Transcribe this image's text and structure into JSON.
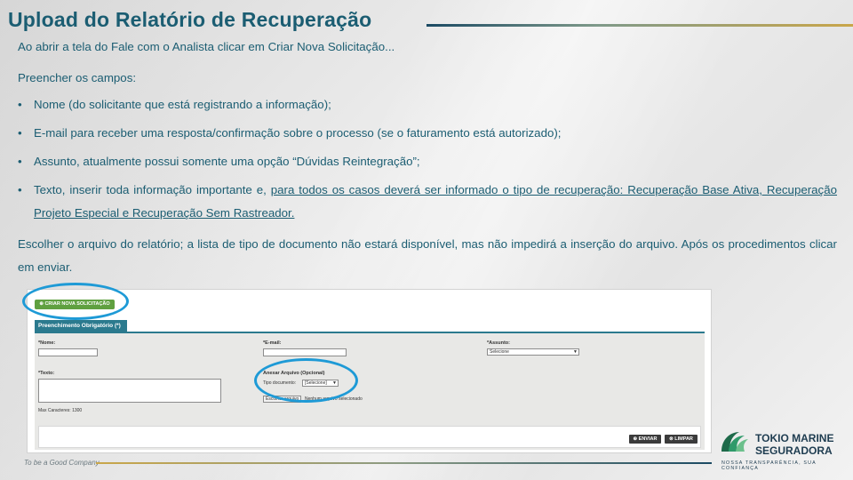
{
  "slide": {
    "title": "Upload do Relatório de Recuperação",
    "intro": "Ao abrir a tela do Fale com o Analista clicar em Criar Nova Solicitação...",
    "fill_fields": "Preencher os campos:",
    "bullets": [
      "Nome (do solicitante que está registrando a informação);",
      "E-mail para receber uma resposta/confirmação sobre o processo (se o faturamento está autorizado);",
      "Assunto, atualmente possui somente uma opção “Dúvidas Reintegração”;"
    ],
    "bullet_text": {
      "prefix": "Texto, inserir toda informação importante e, ",
      "underlined": "para todos os casos deverá ser informado o tipo de recuperação: Recuperação Base Ativa, Recuperação Projeto Especial e Recuperação Sem Rastreador."
    },
    "closing": "Escolher o arquivo do relatório; a lista de tipo de documento não estará disponível, mas não impedirá a inserção do arquivo. Após os procedimentos clicar em enviar.",
    "bullet_symbol": "•"
  },
  "screenshot": {
    "new_request_button": "⊕ CRIAR NOVA SOLICITAÇÃO",
    "required_tab": "Preenchimento Obrigatório (*)",
    "name_label": "*Nome:",
    "email_label": "*E-mail:",
    "subject_label": "*Assunto:",
    "subject_value": "Selecione",
    "text_label": "*Texto:",
    "max_chars": "Max Caracteres: 1300",
    "attach_label": "Anexar Arquivo (Opcional)",
    "doc_type_label": "Tipo documento:",
    "doc_type_value": "[Selecione]",
    "choose_file_button": "Escolher arquivo",
    "no_file_text": "Nenhum arquivo selecionado",
    "send_button": "⊕ ENVIAR",
    "clear_button": "⊗ LIMPAR"
  },
  "footer": {
    "tagline": "To be a Good Company",
    "brand_line1": "TOKIO MARINE",
    "brand_line2": "SEGURADORA",
    "brand_tagline": "NOSSA TRANSPARÊNCIA, SUA CONFIANÇA"
  },
  "colors": {
    "title": "#1b5d72",
    "accent_green": "#5fa040",
    "tab_teal": "#2b7a8e",
    "highlight_circle": "#1e9ad6"
  }
}
